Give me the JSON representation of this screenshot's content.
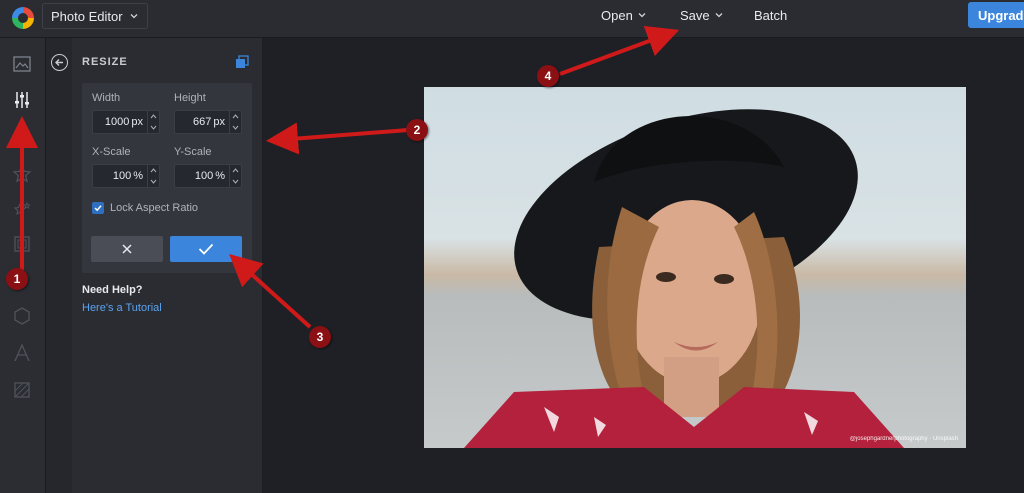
{
  "app": {
    "title": "Photo Editor"
  },
  "topbar": {
    "menu": [
      {
        "label": "Open"
      },
      {
        "label": "Save"
      },
      {
        "label": "Batch"
      }
    ],
    "upgrade_label": "Upgrade"
  },
  "rail": {
    "icons": [
      "image-icon",
      "sliders-icon",
      "crop-icon",
      "star-icon",
      "stars-icon",
      "frame-icon",
      "shape-icon",
      "text-icon",
      "texture-icon"
    ]
  },
  "panel": {
    "title": "RESIZE",
    "width": {
      "label": "Width",
      "value": "1000",
      "unit": "px"
    },
    "height": {
      "label": "Height",
      "value": "667",
      "unit": "px"
    },
    "xscale": {
      "label": "X-Scale",
      "value": "100",
      "unit": "%"
    },
    "yscale": {
      "label": "Y-Scale",
      "value": "100",
      "unit": "%"
    },
    "lock_label": "Lock Aspect Ratio",
    "lock_checked": true,
    "help_title": "Need Help?",
    "help_link": "Here's a Tutorial"
  },
  "photo": {
    "credit": "@josephgardnerphotography · Unsplash"
  },
  "annotations": [
    {
      "number": "1",
      "color": "#8b1014"
    },
    {
      "number": "2",
      "color": "#8b1014"
    },
    {
      "number": "3",
      "color": "#8b1014"
    },
    {
      "number": "4",
      "color": "#8b1014"
    }
  ],
  "colors": {
    "accent": "#3b86dc",
    "annotation_red": "#d01a1a"
  }
}
